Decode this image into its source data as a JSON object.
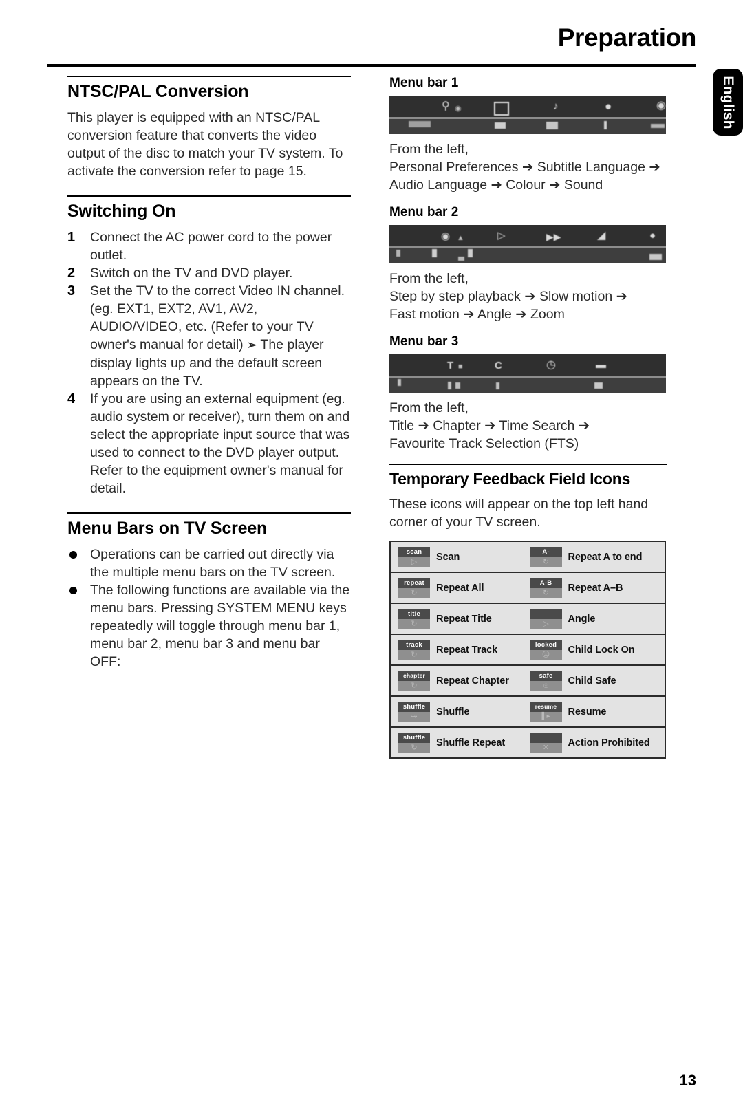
{
  "header": {
    "title": "Preparation",
    "language_tab": "English"
  },
  "left_column": {
    "sections": [
      {
        "id": "ntsc-pal-conversion",
        "title": "NTSC/PAL Conversion",
        "paragraph": "This player is equipped with an NTSC/PAL conversion feature that converts the video output of the disc to match your TV system. To activate the conversion refer to page 15."
      },
      {
        "id": "switching-on",
        "title": "Switching On"
      },
      {
        "id": "menu-bars-on-tv-screen",
        "title": "Menu Bars on TV Screen"
      }
    ],
    "switching_on_steps": [
      {
        "num": "1",
        "text": "Connect the AC power cord to the power outlet."
      },
      {
        "num": "2",
        "text": "Switch on the TV and DVD player."
      },
      {
        "num": "3",
        "text": "Set the TV to the correct Video IN channel. (eg. EXT1, EXT2, AV1, AV2, AUDIO/VIDEO, etc. (Refer to your TV owner's manual for detail)",
        "sub_arrow": "The player display lights up and the default screen appears on the TV."
      },
      {
        "num": "4",
        "text": "If you are using an external equipment (eg. audio system or receiver), turn them on and select the appropriate input source that was used to connect to the DVD player output. Refer to the equipment owner's manual for detail."
      }
    ],
    "menu_bars_bullets": [
      "Operations can be carried out directly via the multiple menu bars on the TV screen.",
      "The following functions are available via the menu bars. Pressing SYSTEM MENU keys repeatedly will toggle through menu bar 1, menu bar 2, menu bar 3 and menu bar OFF:"
    ]
  },
  "right_column": {
    "menu_bars": [
      {
        "label": "Menu bar 1",
        "caption_intro": "From the left,",
        "caption_line1": "Personal Preferences ➔ Subtitle Language ➔",
        "caption_line2": "Audio Language ➔ Colour ➔ Sound"
      },
      {
        "label": "Menu bar 2",
        "caption_intro": "From the left,",
        "caption_line1": "Step by step playback ➔ Slow motion ➔",
        "caption_line2": "Fast motion ➔ Angle ➔ Zoom"
      },
      {
        "label": "Menu bar 3",
        "caption_intro": "From the left,",
        "caption_line1": "Title ➔ Chapter ➔ Time Search ➔",
        "caption_line2": "Favourite Track Selection (FTS)"
      }
    ],
    "feedback_section": {
      "title": "Temporary Feedback Field Icons",
      "paragraph": "These icons will appear on the top left hand corner of your TV screen."
    },
    "feedback_icons": [
      {
        "left": {
          "icon_text": "scan",
          "icon_glyph": "▷",
          "label": "Scan"
        },
        "right": {
          "icon_text": "A-",
          "icon_glyph": "↻",
          "label": "Repeat A to end"
        }
      },
      {
        "left": {
          "icon_text": "repeat",
          "icon_glyph": "↻",
          "label": "Repeat All"
        },
        "right": {
          "icon_text": "A-B",
          "icon_glyph": "↻",
          "label": "Repeat A–B"
        }
      },
      {
        "left": {
          "icon_text": "title",
          "icon_glyph": "↻",
          "label": "Repeat Title"
        },
        "right": {
          "icon_text": "",
          "icon_glyph": "▷",
          "label": "Angle"
        }
      },
      {
        "left": {
          "icon_text": "track",
          "icon_glyph": "↻",
          "label": "Repeat Track"
        },
        "right": {
          "icon_text": "locked",
          "icon_glyph": "☹",
          "label": "Child Lock On"
        }
      },
      {
        "left": {
          "icon_text": "chapter",
          "icon_glyph": "↻",
          "label": "Repeat Chapter"
        },
        "right": {
          "icon_text": "safe",
          "icon_glyph": "☺",
          "label": "Child Safe"
        }
      },
      {
        "left": {
          "icon_text": "shuffle",
          "icon_glyph": "⇝",
          "label": "Shuffle"
        },
        "right": {
          "icon_text": "resume",
          "icon_glyph": "▌▸",
          "label": "Resume"
        }
      },
      {
        "left": {
          "icon_text": "shuffle",
          "icon_glyph": "↻",
          "label": "Shuffle Repeat"
        },
        "right": {
          "icon_text": "",
          "icon_glyph": "✕",
          "label": "Action Prohibited"
        }
      }
    ]
  },
  "footer": {
    "page_number": "13"
  }
}
